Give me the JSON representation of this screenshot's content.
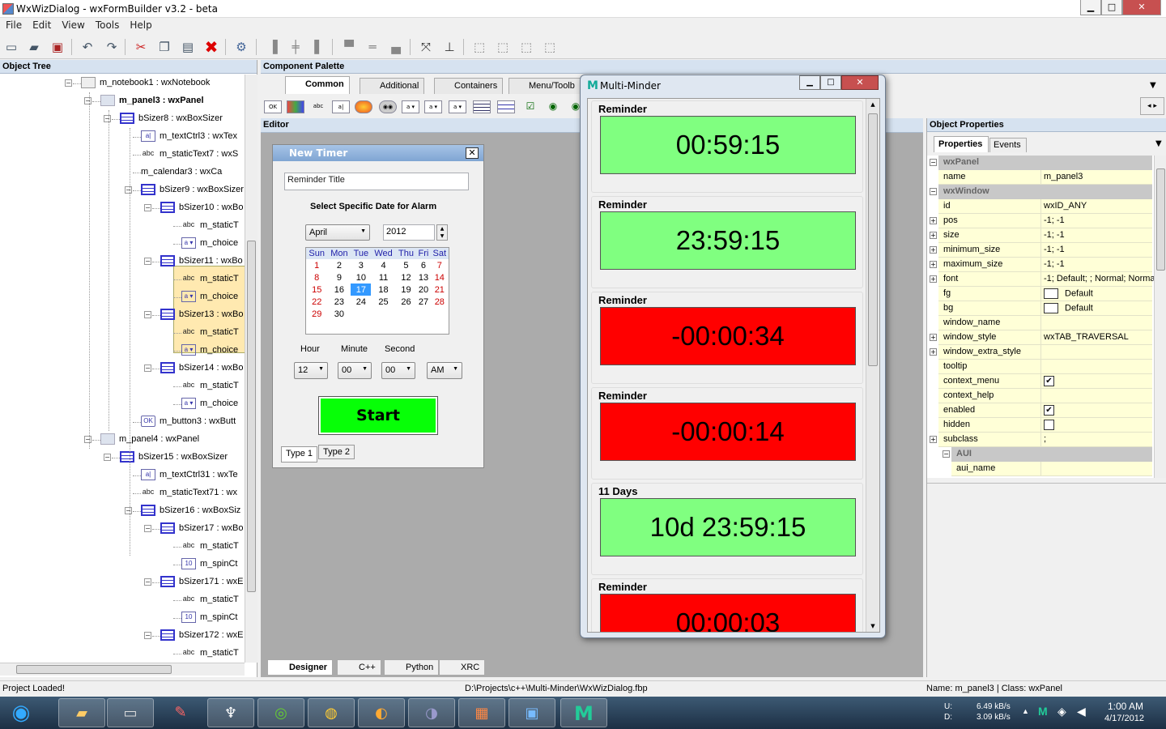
{
  "window": {
    "title": "WxWizDialog - wxFormBuilder v3.2 - beta",
    "btn_min": "▁",
    "btn_max": "□",
    "btn_close": "✕"
  },
  "menu": [
    "File",
    "Edit",
    "View",
    "Tools",
    "Help"
  ],
  "panels": {
    "object_tree": "Object Tree",
    "component_palette": "Component Palette",
    "editor": "Editor",
    "object_properties": "Object Properties"
  },
  "tree": [
    {
      "label": "m_notebook1 : wxNotebook",
      "icon": "nb"
    },
    {
      "label": "m_panel3 : wxPanel",
      "icon": "panel"
    },
    {
      "label": "bSizer8 : wxBoxSizer",
      "icon": "sizer"
    },
    {
      "label": "m_textCtrl3 : wxTex",
      "icon": "txt"
    },
    {
      "label": "m_staticText7 : wxS",
      "icon": "abc"
    },
    {
      "label": "m_calendar3 : wxCa",
      "icon": "cal"
    },
    {
      "label": "bSizer9 : wxBoxSizer",
      "icon": "sizer"
    },
    {
      "label": "bSizer10 : wxBo",
      "icon": "sizer"
    },
    {
      "label": "m_staticT",
      "icon": "abc"
    },
    {
      "label": "m_choice",
      "icon": "choice"
    },
    {
      "label": "bSizer11 : wxBo",
      "icon": "sizer"
    },
    {
      "label": "m_staticT",
      "icon": "abc"
    },
    {
      "label": "m_choice",
      "icon": "choice"
    },
    {
      "label": "bSizer13 : wxBo",
      "icon": "sizer"
    },
    {
      "label": "m_staticT",
      "icon": "abc"
    },
    {
      "label": "m_choice",
      "icon": "choice"
    },
    {
      "label": "bSizer14 : wxBo",
      "icon": "sizer"
    },
    {
      "label": "m_staticT",
      "icon": "abc"
    },
    {
      "label": "m_choice",
      "icon": "choice"
    },
    {
      "label": "m_button3 : wxButt",
      "icon": "btn"
    },
    {
      "label": "m_panel4 : wxPanel",
      "icon": "panel"
    },
    {
      "label": "bSizer15 : wxBoxSizer",
      "icon": "sizer"
    },
    {
      "label": "m_textCtrl31 : wxTe",
      "icon": "txt"
    },
    {
      "label": "m_staticText71 : wx",
      "icon": "abc"
    },
    {
      "label": "bSizer16 : wxBoxSiz",
      "icon": "sizer"
    },
    {
      "label": "bSizer17 : wxBo",
      "icon": "sizer"
    },
    {
      "label": "m_staticT",
      "icon": "abc"
    },
    {
      "label": "m_spinCt",
      "icon": "spin"
    },
    {
      "label": "bSizer171 : wxE",
      "icon": "sizer"
    },
    {
      "label": "m_staticT",
      "icon": "abc"
    },
    {
      "label": "m_spinCt",
      "icon": "spin"
    },
    {
      "label": "bSizer172 : wxE",
      "icon": "sizer"
    },
    {
      "label": "m_staticT",
      "icon": "abc"
    }
  ],
  "icon_text": {
    "abc": "abc",
    "txt": "a|",
    "choice": "a ▾",
    "btn": "OK",
    "spin": "10"
  },
  "palette_tabs": [
    "Common",
    "Additional",
    "Containers",
    "Menu/Toolb"
  ],
  "new_timer": {
    "title": "New Timer",
    "close": "✕",
    "title_placeholder": "Reminder Title",
    "heading": "Select Specific Date for Alarm",
    "month": "April",
    "year": "2012",
    "weekdays": [
      "Sun",
      "Mon",
      "Tue",
      "Wed",
      "Thu",
      "Fri",
      "Sat"
    ],
    "weeks": [
      [
        "1",
        "2",
        "3",
        "4",
        "5",
        "6",
        "7"
      ],
      [
        "8",
        "9",
        "10",
        "11",
        "12",
        "13",
        "14"
      ],
      [
        "15",
        "16",
        "17",
        "18",
        "19",
        "20",
        "21"
      ],
      [
        "22",
        "23",
        "24",
        "25",
        "26",
        "27",
        "28"
      ],
      [
        "29",
        "30",
        "",
        "",
        "",
        "",
        ""
      ]
    ],
    "selected_day": "17",
    "hour_label": "Hour",
    "minute_label": "Minute",
    "second_label": "Second",
    "hour": "12",
    "minute": "00",
    "second": "00",
    "ampm": "AM",
    "start": "Start",
    "tab1": "Type 1",
    "tab2": "Type 2"
  },
  "multi_minder": {
    "title": "Multi-Minder",
    "logo": "M",
    "btn_min": "▁",
    "btn_max": "□",
    "btn_close": "✕",
    "reminders": [
      {
        "label": "Reminder",
        "time": "00:59:15",
        "color": "#80ff80"
      },
      {
        "label": "Reminder",
        "time": "23:59:15",
        "color": "#80ff80"
      },
      {
        "label": "Reminder",
        "time": "-00:00:34",
        "color": "#ff0000"
      },
      {
        "label": "Reminder",
        "time": "-00:00:14",
        "color": "#ff0000"
      },
      {
        "label": "11 Days",
        "time": "10d 23:59:15",
        "color": "#80ff80"
      },
      {
        "label": "Reminder",
        "time": "00:00:03",
        "color": "#ff0000"
      }
    ]
  },
  "props_tabs": [
    "Properties",
    "Events"
  ],
  "properties": [
    {
      "cat": "wxPanel"
    },
    {
      "k": "name",
      "v": "m_panel3"
    },
    {
      "cat": "wxWindow"
    },
    {
      "k": "id",
      "v": "wxID_ANY"
    },
    {
      "k": "pos",
      "v": "-1; -1",
      "exp": true
    },
    {
      "k": "size",
      "v": "-1; -1",
      "exp": true
    },
    {
      "k": "minimum_size",
      "v": "-1; -1",
      "exp": true
    },
    {
      "k": "maximum_size",
      "v": "-1; -1",
      "exp": true
    },
    {
      "k": "font",
      "v": "-1; Default; ; Normal; Norma",
      "exp": true
    },
    {
      "k": "fg",
      "v": "Default",
      "swatch": true
    },
    {
      "k": "bg",
      "v": "Default",
      "swatch": true
    },
    {
      "k": "window_name",
      "v": ""
    },
    {
      "k": "window_style",
      "v": "wxTAB_TRAVERSAL",
      "exp": true
    },
    {
      "k": "window_extra_style",
      "v": "",
      "exp": true
    },
    {
      "k": "tooltip",
      "v": ""
    },
    {
      "k": "context_menu",
      "v": "",
      "check": "✔"
    },
    {
      "k": "context_help",
      "v": ""
    },
    {
      "k": "enabled",
      "v": "",
      "check": "✔"
    },
    {
      "k": "hidden",
      "v": "",
      "check": ""
    },
    {
      "k": "subclass",
      "v": ";",
      "exp": true
    },
    {
      "cat": "AUI",
      "sub": true
    },
    {
      "k": "aui_name",
      "v": "",
      "sub": true
    }
  ],
  "bottom_tabs": [
    "Designer",
    "C++",
    "Python",
    "XRC"
  ],
  "status": {
    "left": "Project Loaded!",
    "middle": "D:\\Projects\\c++\\Multi-Minder\\WxWizDialog.fbp",
    "right": "Name: m_panel3 | Class: wxPanel"
  },
  "tray": {
    "up_label": "U:",
    "down_label": "D:",
    "up": "6.49 kB/s",
    "down": "3.09 kB/s",
    "time": "1:00 AM",
    "date": "4/17/2012"
  },
  "taskbar_apps": [
    "start-orb",
    "explorer",
    "console",
    "snipping",
    "alien",
    "spotify",
    "chrome",
    "ultraedit",
    "eclipse",
    "windows",
    "wxformbuilder",
    "multiminder"
  ]
}
